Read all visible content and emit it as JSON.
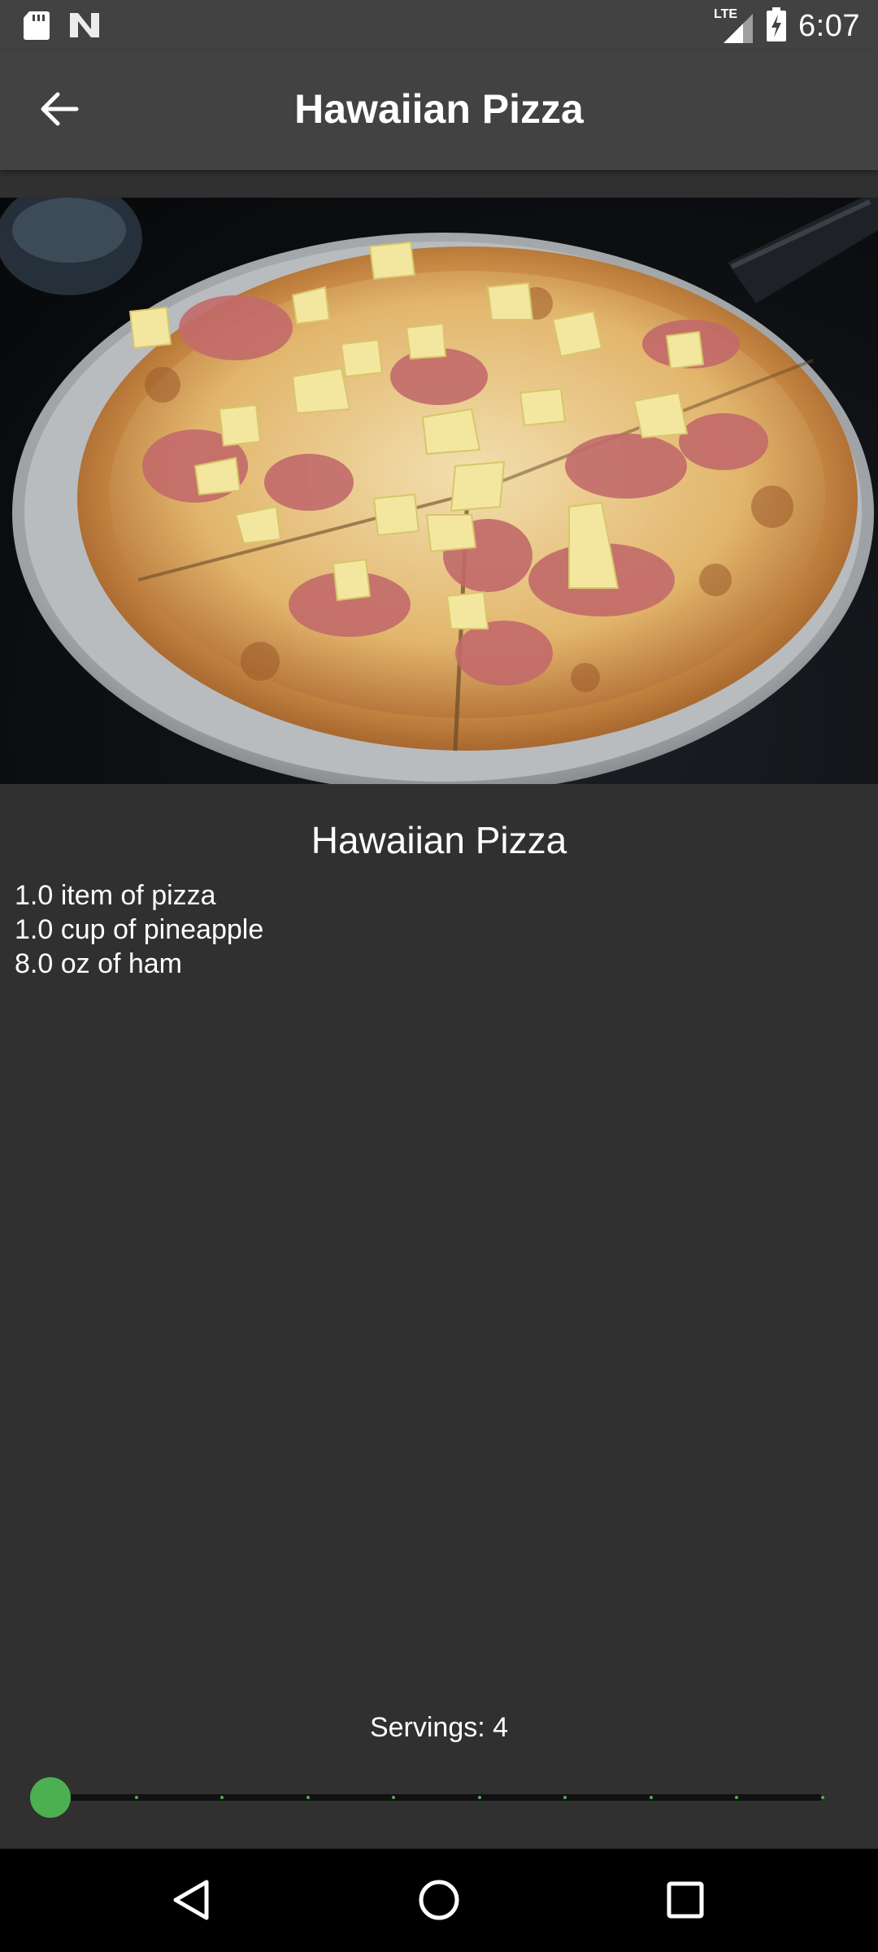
{
  "status_bar": {
    "time": "6:07",
    "network_label": "LTE",
    "left_icons": [
      "sd-card-icon",
      "app-notification-icon"
    ],
    "right_icons": [
      "lte-signal-icon",
      "battery-charging-icon"
    ]
  },
  "app_bar": {
    "title": "Hawaiian Pizza",
    "back_icon": "arrow-back-icon"
  },
  "hero_image": {
    "subject": "hawaiian-pizza-photo"
  },
  "recipe": {
    "title": "Hawaiian Pizza",
    "ingredients": [
      "1.0 item of pizza",
      "1.0 cup of pineapple",
      "8.0 oz of ham"
    ]
  },
  "servings": {
    "label": "Servings: 4",
    "value": 4,
    "min": 4,
    "max": 40,
    "divisions": 9,
    "accent_color": "#4caf50"
  },
  "nav_bar": {
    "icons": [
      "back-triangle-icon",
      "home-circle-icon",
      "recents-square-icon"
    ]
  },
  "colors": {
    "background": "#303030",
    "app_bar": "#424242",
    "text": "#ffffff",
    "accent": "#4caf50"
  }
}
